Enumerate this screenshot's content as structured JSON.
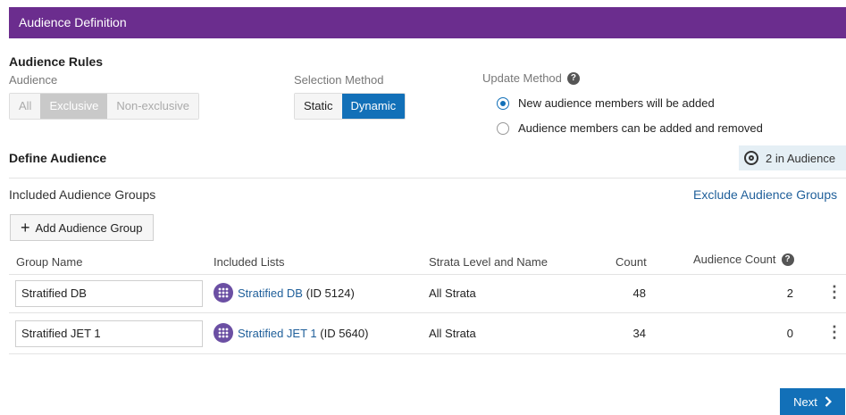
{
  "header": {
    "title": "Audience Definition"
  },
  "rules": {
    "title": "Audience Rules",
    "audience_label": "Audience",
    "audience_options": [
      "All",
      "Exclusive",
      "Non-exclusive"
    ],
    "audience_selected": "Exclusive",
    "selection_label": "Selection Method",
    "selection_options": [
      "Static",
      "Dynamic"
    ],
    "selection_selected": "Dynamic",
    "update_label": "Update Method",
    "update_options": [
      "New audience members will be added",
      "Audience members can be added and removed"
    ],
    "update_selected": "New audience members will be added"
  },
  "define": {
    "title": "Define Audience",
    "badge": "2 in Audience",
    "included_title": "Included Audience Groups",
    "exclude_link": "Exclude Audience Groups",
    "add_button": "Add Audience Group"
  },
  "table": {
    "headers": [
      "Group Name",
      "Included Lists",
      "Strata Level and Name",
      "Count",
      "Audience Count"
    ],
    "rows": [
      {
        "group": "Stratified DB",
        "list_name": "Stratified DB",
        "list_id": "(ID 5124)",
        "strata": "All Strata",
        "count": "48",
        "audience_count": "2"
      },
      {
        "group": "Stratified JET 1",
        "list_name": "Stratified JET 1",
        "list_id": "(ID 5640)",
        "strata": "All Strata",
        "count": "34",
        "audience_count": "0"
      }
    ]
  },
  "footer": {
    "next": "Next"
  },
  "colors": {
    "header": "#6b2d8e",
    "accent": "#1270b8"
  }
}
